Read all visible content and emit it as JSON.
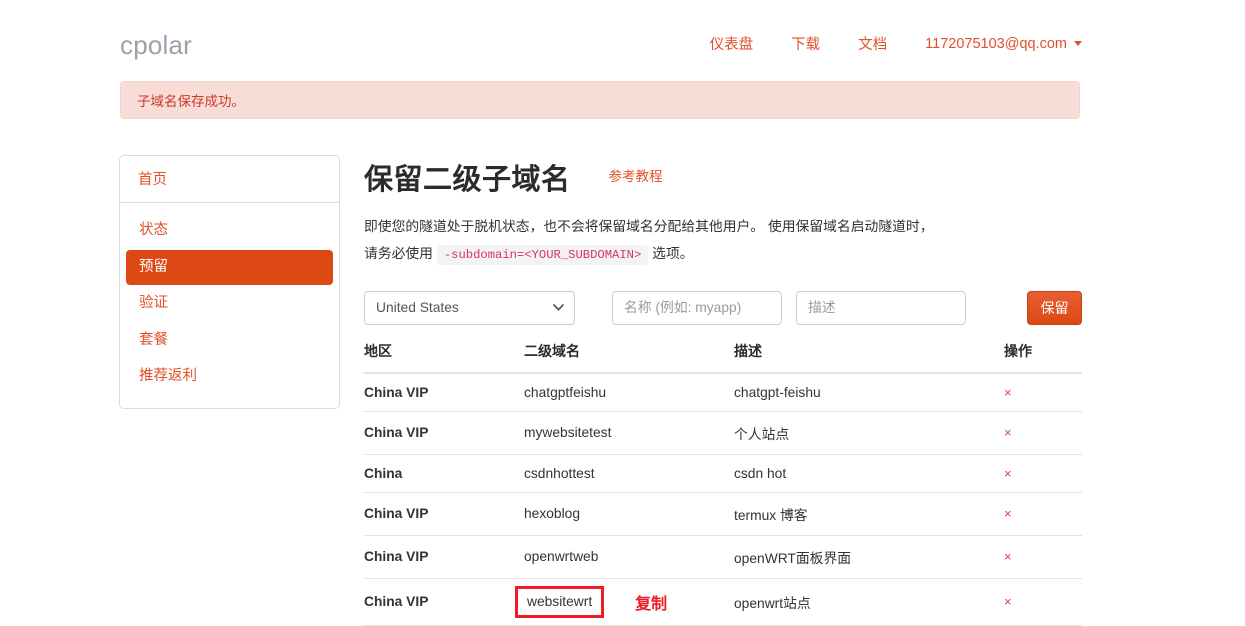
{
  "navbar": {
    "brand": "cpolar",
    "links": [
      {
        "label": "仪表盘",
        "name": "dashboard"
      },
      {
        "label": "下载",
        "name": "download"
      },
      {
        "label": "文档",
        "name": "docs"
      }
    ],
    "user": "1172075103@qq.com",
    "caret_icon": "chevron-down-icon"
  },
  "alert": {
    "message": "子域名保存成功。",
    "bg_color": "#f8dcd8",
    "text_color": "#cf3a28"
  },
  "sidebar": {
    "home": "首页",
    "items": [
      {
        "label": "状态",
        "active": false
      },
      {
        "label": "预留",
        "active": true
      },
      {
        "label": "验证",
        "active": false
      },
      {
        "label": "套餐",
        "active": false
      },
      {
        "label": "推荐返利",
        "active": false
      }
    ],
    "active_bg": "#dd4814",
    "link_color": "#e0512a"
  },
  "main": {
    "title": "保留二级子域名",
    "tutorial_link": "参考教程",
    "desc_part1": "即使您的隧道处于脱机状态，也不会将保留域名分配给其他用户。 使用保留域名启动隧道时，请务必使用",
    "desc_code": "-subdomain=<YOUR_SUBDOMAIN>",
    "desc_part2": "选项。"
  },
  "form": {
    "region_value": "United States",
    "region_options": [
      "United States",
      "China",
      "China VIP"
    ],
    "name_placeholder": "名称 (例如: myapp)",
    "name_value": "",
    "desc_placeholder": "描述",
    "desc_value": "",
    "save_label": "保留",
    "save_color": "#dd4814"
  },
  "table": {
    "headers": {
      "region": "地区",
      "domain": "二级域名",
      "description": "描述",
      "action": "操作"
    },
    "delete_icon": "×",
    "rows": [
      {
        "region": "China VIP",
        "domain": "chatgptfeishu",
        "description": "chatgpt-feishu",
        "highlighted": false
      },
      {
        "region": "China VIP",
        "domain": "mywebsitetest",
        "description": "个人站点",
        "highlighted": false
      },
      {
        "region": "China",
        "domain": "csdnhottest",
        "description": "csdn hot",
        "highlighted": false
      },
      {
        "region": "China VIP",
        "domain": "hexoblog",
        "description": "termux 博客",
        "highlighted": false
      },
      {
        "region": "China VIP",
        "domain": "openwrtweb",
        "description": "openWRT面板界面",
        "highlighted": false
      },
      {
        "region": "China VIP",
        "domain": "websitewrt",
        "description": "openwrt站点",
        "highlighted": true
      }
    ]
  },
  "annotation": {
    "copy_label": "复制",
    "box_color": "#ef1c24"
  }
}
